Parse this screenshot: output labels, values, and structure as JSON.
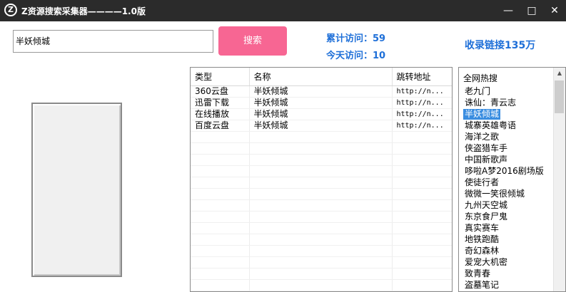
{
  "window": {
    "logo_letter": "Z",
    "title": "Z资源搜索采集器————1.0版",
    "minimize_glyph": "—",
    "maximize_glyph": "□",
    "close_glyph": "✕"
  },
  "search": {
    "value": "半妖倾城",
    "button_label": "搜索"
  },
  "stats": {
    "total_visits": "累计访问：59",
    "today_visits": "今天访问：10",
    "indexed_links": "收录链接135万"
  },
  "results": {
    "columns": [
      "类型",
      "名称",
      "跳转地址"
    ],
    "rows": [
      {
        "type": "360云盘",
        "name": "半妖倾城",
        "url": "http://n..."
      },
      {
        "type": "迅雷下载",
        "name": "半妖倾城",
        "url": "http://n..."
      },
      {
        "type": "在线播放",
        "name": "半妖倾城",
        "url": "http://n..."
      },
      {
        "type": "百度云盘",
        "name": "半妖倾城",
        "url": "http://n..."
      }
    ]
  },
  "hot": {
    "header": "全网热搜",
    "items": [
      "老九门",
      "诛仙：青云志",
      "半妖倾城",
      "城寨英雄粤语",
      "海洋之歌",
      "侠盗猎车手",
      "中国新歌声",
      "哆啦A梦2016剧场版",
      "使徒行者",
      "微微一笑很倾城",
      "九州天空城",
      "东京食尸鬼",
      "真实赛车",
      "地铁跑酷",
      "奇幻森林",
      "爱宠大机密",
      "致青春",
      "盗墓笔记"
    ],
    "selected": "半妖倾城"
  },
  "colors": {
    "titlebar": "#2b2b2b",
    "search_button": "#f76693",
    "stats_text": "#1e6fd8",
    "selection": "#3a8de0"
  }
}
